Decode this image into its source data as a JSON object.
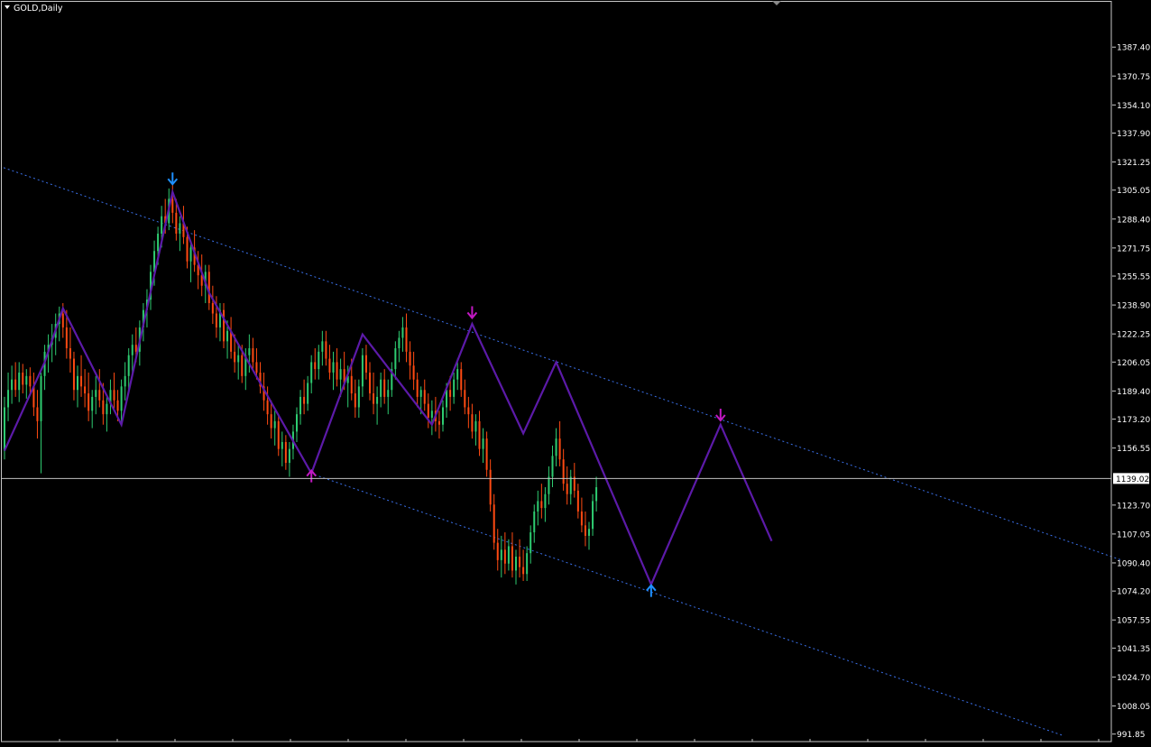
{
  "window": {
    "title": "GOLD,Daily",
    "menu_icon": "triangle-down-icon",
    "scroll_marker_icon": "chart-shift-marker-icon"
  },
  "colors": {
    "background": "#000000",
    "frame": "#c8c8c8",
    "text": "#ffffff",
    "bull_candle": "#2ecc71",
    "bear_candle": "#ff4a12",
    "zigzag": "#5c1aa8",
    "channel": "#3a6fe8",
    "current_price_line": "#c0c0c0",
    "arrow_blue": "#1e90ff",
    "arrow_magenta": "#c218c2"
  },
  "chart_data": {
    "type": "candlestick",
    "symbol": "GOLD",
    "timeframe": "Daily",
    "y_axis": {
      "ticks": [
        "1387.40",
        "1370.75",
        "1354.10",
        "1337.90",
        "1321.25",
        "1305.05",
        "1288.40",
        "1271.75",
        "1255.55",
        "1238.90",
        "1222.25",
        "1206.05",
        "1189.40",
        "1173.20",
        "1156.55",
        "1139.02",
        "1123.70",
        "1107.05",
        "1090.40",
        "1074.20",
        "1057.55",
        "1041.35",
        "1024.70",
        "1008.05",
        "991.85"
      ],
      "tick_values": [
        1387.4,
        1370.75,
        1354.1,
        1337.9,
        1321.25,
        1305.05,
        1288.4,
        1271.75,
        1255.55,
        1238.9,
        1222.25,
        1206.05,
        1189.4,
        1173.2,
        1156.55,
        1139.02,
        1123.7,
        1107.05,
        1090.4,
        1074.2,
        1057.55,
        1041.35,
        1024.7,
        1008.05,
        991.85
      ],
      "range": [
        987.0,
        1400.5
      ],
      "position": "right"
    },
    "current_price": 1139.02,
    "current_price_label": "1139.02",
    "zigzag_pivots": [
      {
        "bar": 0,
        "price": 1155
      },
      {
        "bar": 11,
        "price": 1206
      },
      {
        "bar": 16,
        "price": 1237
      },
      {
        "bar": 32,
        "price": 1170
      },
      {
        "bar": 46,
        "price": 1304
      },
      {
        "bar": 56,
        "price": 1246
      },
      {
        "bar": 84,
        "price": 1142
      },
      {
        "bar": 98,
        "price": 1222
      },
      {
        "bar": 117,
        "price": 1170
      },
      {
        "bar": 128,
        "price": 1228
      },
      {
        "bar": 142,
        "price": 1165
      },
      {
        "bar": 151,
        "price": 1206
      },
      {
        "bar": 177,
        "price": 1078
      },
      {
        "bar": 196,
        "price": 1170
      },
      {
        "bar": 210,
        "price": 1103
      }
    ],
    "fractal_arrows": [
      {
        "bar": 46,
        "price": 1310,
        "direction": "down",
        "color": "blue"
      },
      {
        "bar": 84,
        "price": 1142,
        "direction": "up",
        "color": "magenta"
      },
      {
        "bar": 128,
        "price": 1233,
        "direction": "down",
        "color": "magenta"
      },
      {
        "bar": 177,
        "price": 1076,
        "direction": "up",
        "color": "blue"
      },
      {
        "bar": 196,
        "price": 1174,
        "direction": "down",
        "color": "magenta"
      }
    ],
    "channel_lines": [
      {
        "name": "upper",
        "from": {
          "bar": 0,
          "price": 1318
        },
        "to": {
          "bar": 306,
          "price": 1092
        }
      },
      {
        "name": "lower",
        "from": {
          "bar": 84,
          "price": 1142
        },
        "to": {
          "bar": 290,
          "price": 991
        }
      }
    ],
    "bars": 216,
    "ohlc": [
      [
        1155,
        1186,
        1150,
        1180
      ],
      [
        1180,
        1200,
        1172,
        1190
      ],
      [
        1190,
        1204,
        1182,
        1196
      ],
      [
        1196,
        1206,
        1186,
        1190
      ],
      [
        1190,
        1206,
        1183,
        1200
      ],
      [
        1200,
        1205,
        1188,
        1193
      ],
      [
        1193,
        1202,
        1185,
        1198
      ],
      [
        1198,
        1203,
        1188,
        1192
      ],
      [
        1192,
        1200,
        1175,
        1180
      ],
      [
        1180,
        1190,
        1162,
        1172
      ],
      [
        1172,
        1200,
        1142,
        1198
      ],
      [
        1198,
        1216,
        1190,
        1212
      ],
      [
        1212,
        1222,
        1200,
        1216
      ],
      [
        1216,
        1228,
        1206,
        1220
      ],
      [
        1220,
        1234,
        1210,
        1228
      ],
      [
        1228,
        1238,
        1218,
        1234
      ],
      [
        1234,
        1240,
        1220,
        1226
      ],
      [
        1226,
        1236,
        1208,
        1214
      ],
      [
        1214,
        1226,
        1200,
        1208
      ],
      [
        1208,
        1212,
        1184,
        1190
      ],
      [
        1190,
        1204,
        1180,
        1198
      ],
      [
        1198,
        1210,
        1186,
        1192
      ],
      [
        1192,
        1202,
        1180,
        1188
      ],
      [
        1188,
        1200,
        1172,
        1178
      ],
      [
        1178,
        1190,
        1168,
        1186
      ],
      [
        1186,
        1198,
        1176,
        1190
      ],
      [
        1190,
        1202,
        1180,
        1184
      ],
      [
        1184,
        1194,
        1170,
        1176
      ],
      [
        1176,
        1186,
        1166,
        1182
      ],
      [
        1182,
        1196,
        1176,
        1190
      ],
      [
        1190,
        1200,
        1178,
        1184
      ],
      [
        1184,
        1190,
        1172,
        1178
      ],
      [
        1178,
        1196,
        1170,
        1192
      ],
      [
        1192,
        1206,
        1184,
        1198
      ],
      [
        1198,
        1214,
        1190,
        1210
      ],
      [
        1210,
        1222,
        1200,
        1216
      ],
      [
        1216,
        1226,
        1206,
        1212
      ],
      [
        1212,
        1230,
        1204,
        1226
      ],
      [
        1226,
        1240,
        1218,
        1236
      ],
      [
        1236,
        1248,
        1226,
        1242
      ],
      [
        1242,
        1262,
        1236,
        1258
      ],
      [
        1258,
        1276,
        1250,
        1270
      ],
      [
        1270,
        1284,
        1262,
        1280
      ],
      [
        1280,
        1296,
        1272,
        1290
      ],
      [
        1290,
        1300,
        1280,
        1286
      ],
      [
        1286,
        1306,
        1282,
        1300
      ],
      [
        1300,
        1308,
        1286,
        1292
      ],
      [
        1292,
        1300,
        1276,
        1280
      ],
      [
        1280,
        1290,
        1270,
        1286
      ],
      [
        1286,
        1296,
        1274,
        1278
      ],
      [
        1278,
        1284,
        1260,
        1264
      ],
      [
        1264,
        1276,
        1252,
        1272
      ],
      [
        1272,
        1282,
        1258,
        1262
      ],
      [
        1262,
        1270,
        1248,
        1256
      ],
      [
        1256,
        1268,
        1244,
        1250
      ],
      [
        1250,
        1262,
        1240,
        1258
      ],
      [
        1258,
        1262,
        1236,
        1240
      ],
      [
        1240,
        1250,
        1228,
        1234
      ],
      [
        1234,
        1244,
        1220,
        1226
      ],
      [
        1226,
        1240,
        1218,
        1236
      ],
      [
        1236,
        1240,
        1214,
        1218
      ],
      [
        1218,
        1230,
        1208,
        1224
      ],
      [
        1224,
        1232,
        1208,
        1212
      ],
      [
        1212,
        1222,
        1200,
        1206
      ],
      [
        1206,
        1216,
        1196,
        1210
      ],
      [
        1210,
        1216,
        1194,
        1198
      ],
      [
        1198,
        1214,
        1190,
        1210
      ],
      [
        1210,
        1222,
        1200,
        1214
      ],
      [
        1214,
        1220,
        1202,
        1206
      ],
      [
        1206,
        1214,
        1196,
        1200
      ],
      [
        1200,
        1206,
        1188,
        1192
      ],
      [
        1192,
        1200,
        1178,
        1184
      ],
      [
        1184,
        1192,
        1170,
        1176
      ],
      [
        1176,
        1184,
        1162,
        1168
      ],
      [
        1168,
        1178,
        1158,
        1172
      ],
      [
        1172,
        1176,
        1152,
        1156
      ],
      [
        1156,
        1166,
        1146,
        1160
      ],
      [
        1160,
        1164,
        1144,
        1148
      ],
      [
        1148,
        1160,
        1140,
        1156
      ],
      [
        1156,
        1170,
        1150,
        1166
      ],
      [
        1166,
        1180,
        1160,
        1176
      ],
      [
        1176,
        1190,
        1170,
        1186
      ],
      [
        1186,
        1196,
        1176,
        1182
      ],
      [
        1182,
        1198,
        1178,
        1194
      ],
      [
        1194,
        1210,
        1188,
        1206
      ],
      [
        1206,
        1214,
        1196,
        1202
      ],
      [
        1202,
        1216,
        1196,
        1212
      ],
      [
        1212,
        1224,
        1204,
        1218
      ],
      [
        1218,
        1224,
        1204,
        1208
      ],
      [
        1208,
        1216,
        1196,
        1200
      ],
      [
        1200,
        1212,
        1190,
        1206
      ],
      [
        1206,
        1214,
        1192,
        1196
      ],
      [
        1196,
        1208,
        1186,
        1202
      ],
      [
        1202,
        1212,
        1190,
        1194
      ],
      [
        1194,
        1204,
        1180,
        1198
      ],
      [
        1198,
        1208,
        1184,
        1188
      ],
      [
        1188,
        1196,
        1174,
        1180
      ],
      [
        1180,
        1196,
        1174,
        1192
      ],
      [
        1192,
        1214,
        1186,
        1210
      ],
      [
        1210,
        1216,
        1196,
        1200
      ],
      [
        1200,
        1206,
        1184,
        1188
      ],
      [
        1188,
        1200,
        1176,
        1182
      ],
      [
        1182,
        1192,
        1170,
        1186
      ],
      [
        1186,
        1200,
        1180,
        1196
      ],
      [
        1196,
        1202,
        1182,
        1186
      ],
      [
        1186,
        1196,
        1176,
        1190
      ],
      [
        1190,
        1206,
        1186,
        1202
      ],
      [
        1202,
        1218,
        1196,
        1214
      ],
      [
        1214,
        1224,
        1206,
        1220
      ],
      [
        1220,
        1232,
        1212,
        1226
      ],
      [
        1226,
        1234,
        1206,
        1212
      ],
      [
        1212,
        1218,
        1196,
        1204
      ],
      [
        1204,
        1212,
        1190,
        1196
      ],
      [
        1196,
        1200,
        1180,
        1186
      ],
      [
        1186,
        1192,
        1176,
        1190
      ],
      [
        1190,
        1196,
        1178,
        1182
      ],
      [
        1182,
        1188,
        1168,
        1174
      ],
      [
        1174,
        1184,
        1164,
        1178
      ],
      [
        1178,
        1186,
        1166,
        1172
      ],
      [
        1172,
        1178,
        1162,
        1170
      ],
      [
        1170,
        1184,
        1166,
        1180
      ],
      [
        1180,
        1194,
        1174,
        1190
      ],
      [
        1190,
        1198,
        1178,
        1186
      ],
      [
        1186,
        1200,
        1182,
        1196
      ],
      [
        1196,
        1208,
        1190,
        1202
      ],
      [
        1202,
        1206,
        1186,
        1190
      ],
      [
        1190,
        1196,
        1176,
        1180
      ],
      [
        1180,
        1186,
        1168,
        1176
      ],
      [
        1176,
        1182,
        1162,
        1166
      ],
      [
        1166,
        1176,
        1158,
        1172
      ],
      [
        1172,
        1178,
        1152,
        1156
      ],
      [
        1156,
        1168,
        1148,
        1162
      ],
      [
        1162,
        1166,
        1140,
        1144
      ],
      [
        1144,
        1150,
        1120,
        1124
      ],
      [
        1124,
        1130,
        1098,
        1102
      ],
      [
        1102,
        1110,
        1086,
        1092
      ],
      [
        1092,
        1106,
        1082,
        1098
      ],
      [
        1098,
        1108,
        1084,
        1090
      ],
      [
        1090,
        1104,
        1086,
        1100
      ],
      [
        1100,
        1108,
        1082,
        1086
      ],
      [
        1086,
        1098,
        1078,
        1094
      ],
      [
        1094,
        1104,
        1082,
        1088
      ],
      [
        1088,
        1098,
        1080,
        1084
      ],
      [
        1084,
        1100,
        1080,
        1096
      ],
      [
        1096,
        1112,
        1090,
        1108
      ],
      [
        1108,
        1124,
        1102,
        1120
      ],
      [
        1120,
        1132,
        1112,
        1126
      ],
      [
        1126,
        1136,
        1116,
        1122
      ],
      [
        1122,
        1134,
        1114,
        1130
      ],
      [
        1130,
        1146,
        1124,
        1140
      ],
      [
        1140,
        1158,
        1134,
        1152
      ],
      [
        1152,
        1168,
        1146,
        1162
      ],
      [
        1162,
        1172,
        1146,
        1150
      ],
      [
        1150,
        1156,
        1132,
        1136
      ],
      [
        1136,
        1146,
        1124,
        1130
      ],
      [
        1130,
        1144,
        1124,
        1140
      ],
      [
        1140,
        1148,
        1128,
        1132
      ],
      [
        1132,
        1136,
        1116,
        1120
      ],
      [
        1120,
        1128,
        1108,
        1112
      ],
      [
        1112,
        1120,
        1100,
        1106
      ],
      [
        1106,
        1114,
        1098,
        1110
      ],
      [
        1110,
        1130,
        1106,
        1126
      ],
      [
        1126,
        1140,
        1120,
        1134
      ]
    ]
  }
}
